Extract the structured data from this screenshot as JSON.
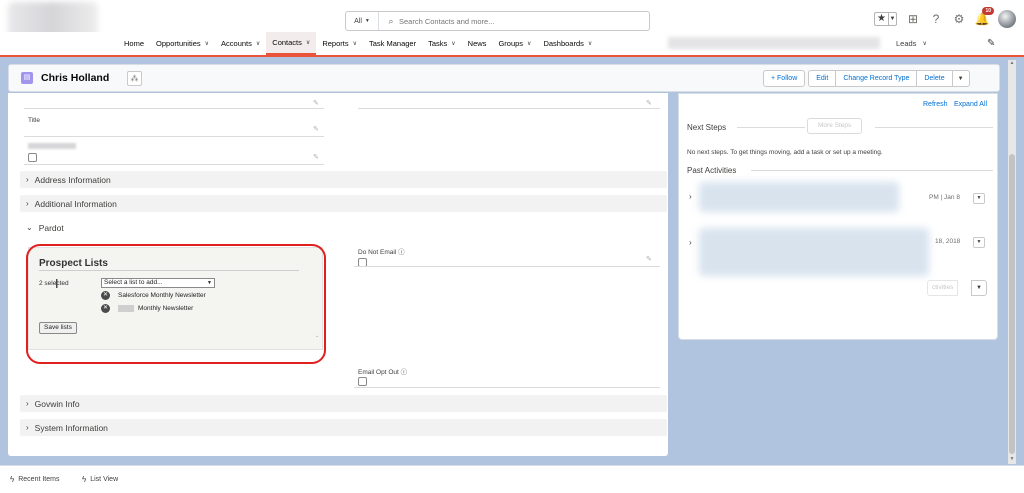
{
  "header": {
    "search_scope": "All",
    "search_placeholder": "Search Contacts and more...",
    "notification_count": "10"
  },
  "nav": {
    "items": [
      {
        "label": "Home",
        "has_menu": false
      },
      {
        "label": "Opportunities",
        "has_menu": true
      },
      {
        "label": "Accounts",
        "has_menu": true
      },
      {
        "label": "Contacts",
        "has_menu": true,
        "active": true
      },
      {
        "label": "Reports",
        "has_menu": true
      },
      {
        "label": "Task Manager",
        "has_menu": false
      },
      {
        "label": "Tasks",
        "has_menu": true
      },
      {
        "label": "News",
        "has_menu": false
      },
      {
        "label": "Groups",
        "has_menu": true
      },
      {
        "label": "Dashboards",
        "has_menu": true
      }
    ],
    "right_item": "Leads"
  },
  "record": {
    "name": "Chris Holland",
    "actions": {
      "follow": "+ Follow",
      "edit": "Edit",
      "change_record_type": "Change Record Type",
      "delete": "Delete"
    }
  },
  "details": {
    "title_label": "Title",
    "do_not_email_label": "Do Not Email",
    "email_opt_out_label": "Email Opt Out",
    "sections": {
      "address": "Address Information",
      "additional": "Additional Information",
      "pardot": "Pardot",
      "govwin": "Govwin Info",
      "system": "System Information"
    }
  },
  "pardot": {
    "title": "Prospect Lists",
    "selected_count": "2 selected",
    "select_placeholder": "Select a list to add...",
    "lists": [
      "Salesforce Monthly Newsletter",
      "Monthly Newsletter"
    ],
    "save_button": "Save lists"
  },
  "activity": {
    "refresh": "Refresh",
    "expand_all": "Expand All",
    "next_steps_title": "Next Steps",
    "more_steps": "More Steps",
    "no_steps_text": "No next steps. To get things moving, add a task or set up a meeting.",
    "past_title": "Past Activities",
    "past_items": [
      {
        "date_fragment": "PM | Jan 8"
      },
      {
        "date_fragment": "18, 2018"
      }
    ],
    "faded_button": "ctivities"
  },
  "footer": {
    "recent_items": "Recent Items",
    "list_view": "List View"
  }
}
